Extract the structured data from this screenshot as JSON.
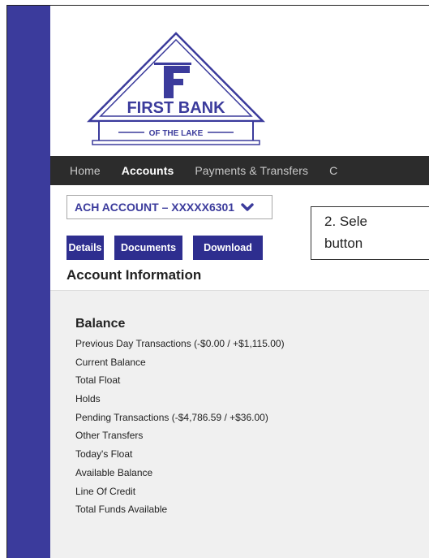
{
  "logo": {
    "name_line1": "FIRST BANK",
    "name_line2": "OF THE LAKE",
    "brand_color": "#3b3b9c"
  },
  "nav": {
    "items": [
      {
        "label": "Home",
        "active": false
      },
      {
        "label": "Accounts",
        "active": true
      },
      {
        "label": "Payments & Transfers",
        "active": false
      },
      {
        "label": "C",
        "active": false
      }
    ]
  },
  "account_select": {
    "value": "ACH ACCOUNT – XXXXX6301",
    "icon": "chevron-down-icon"
  },
  "buttons": {
    "details": "Details",
    "documents": "Documents",
    "download": "Download"
  },
  "callout": {
    "line1": "2.  Sele",
    "line2": "button"
  },
  "account_info": {
    "title": "Account Information"
  },
  "balance": {
    "title": "Balance",
    "items": [
      "Previous Day Transactions (-$0.00 / +$1,115.00)",
      "Current Balance",
      "Total Float",
      "Holds",
      "Pending Transactions (-$4,786.59 / +$36.00)",
      "Other Transfers",
      "Today's Float",
      "Available Balance",
      "Line Of Credit",
      "Total Funds Available"
    ]
  }
}
